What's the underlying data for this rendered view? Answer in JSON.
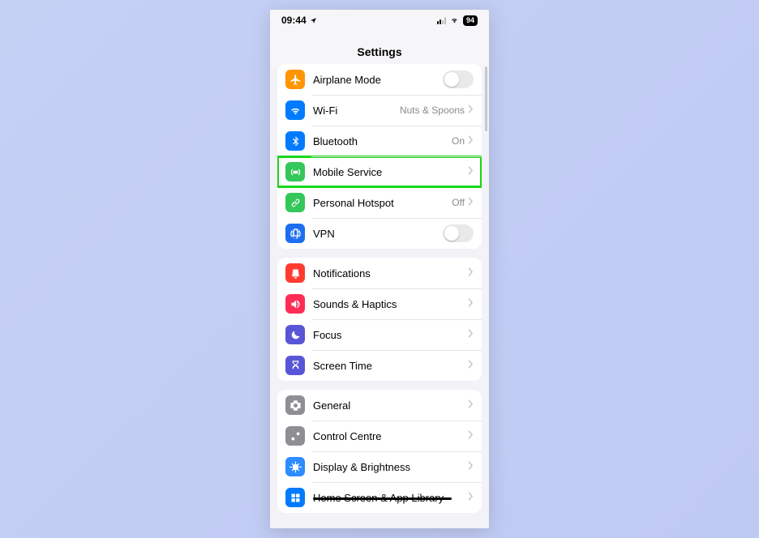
{
  "statusbar": {
    "time": "09:44",
    "battery": "94"
  },
  "header": {
    "title": "Settings"
  },
  "groups": [
    {
      "rows": [
        {
          "icon": "airplane",
          "bg": "bg-orange",
          "label": "Airplane Mode",
          "kind": "toggle"
        },
        {
          "icon": "wifi",
          "bg": "bg-blue",
          "label": "Wi-Fi",
          "value": "Nuts & Spoons",
          "kind": "nav"
        },
        {
          "icon": "bluetooth",
          "bg": "bg-blue",
          "label": "Bluetooth",
          "value": "On",
          "kind": "nav"
        },
        {
          "icon": "antenna",
          "bg": "bg-green",
          "label": "Mobile Service",
          "kind": "nav",
          "highlight": true
        },
        {
          "icon": "link",
          "bg": "bg-green",
          "label": "Personal Hotspot",
          "value": "Off",
          "kind": "nav"
        },
        {
          "icon": "globe",
          "bg": "bg-darkblue",
          "label": "VPN",
          "kind": "toggle"
        }
      ]
    },
    {
      "rows": [
        {
          "icon": "bell",
          "bg": "bg-red",
          "label": "Notifications",
          "kind": "nav"
        },
        {
          "icon": "speaker",
          "bg": "bg-pink",
          "label": "Sounds & Haptics",
          "kind": "nav"
        },
        {
          "icon": "moon",
          "bg": "bg-indigo",
          "label": "Focus",
          "kind": "nav"
        },
        {
          "icon": "hourglass",
          "bg": "bg-indigo",
          "label": "Screen Time",
          "kind": "nav"
        }
      ]
    },
    {
      "rows": [
        {
          "icon": "gear",
          "bg": "bg-gray",
          "label": "General",
          "kind": "nav"
        },
        {
          "icon": "switches",
          "bg": "bg-gray",
          "label": "Control Centre",
          "kind": "nav"
        },
        {
          "icon": "sun",
          "bg": "bg-lightblue",
          "label": "Display & Brightness",
          "kind": "nav"
        },
        {
          "icon": "grid",
          "bg": "bg-bluesolid",
          "label": "Home Screen & App Library",
          "kind": "nav",
          "struck": true
        }
      ]
    }
  ]
}
